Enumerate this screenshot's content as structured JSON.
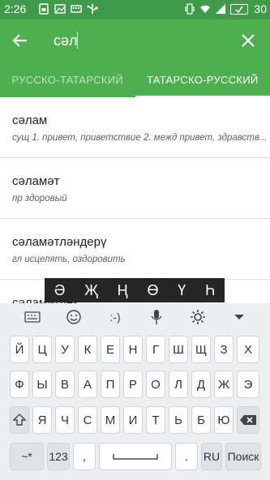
{
  "status": {
    "time": "2:26",
    "battery": "30",
    "icons": [
      "sim-icon",
      "gallery-icon",
      "usb-icon",
      "usb-debug-icon",
      "vibrate-icon",
      "wifi-icon",
      "signal-icon",
      "battery-icon"
    ]
  },
  "colors": {
    "statusbar": "#3f9a49",
    "toolbar": "#4caf50",
    "special_bar": "#262626",
    "keyboard_bg": "#eceff1"
  },
  "search": {
    "query": "сәл",
    "placeholder": ""
  },
  "tabs": [
    {
      "label": "РУССКО-ТАТАРСКИЙ",
      "active": false
    },
    {
      "label": "ТАТАРСКО-РУССКИЙ",
      "active": true
    }
  ],
  "results": [
    {
      "word": "сәлам",
      "definition": "сущ 1. привет, приветствие 2. межд привет, здравств..."
    },
    {
      "word": "сәламәт",
      "definition": "пр здоровый"
    },
    {
      "word": "сәламәтләндерү",
      "definition": "гл исцелять, оздоровить"
    },
    {
      "word": "сәламәтлек",
      "definition": ""
    }
  ],
  "special_chars": [
    "Ә",
    "Җ",
    "Ң",
    "Ө",
    "Ү",
    "Һ"
  ],
  "keyboard": {
    "toolbar_icons": [
      "keyboard-icon",
      "emoji-icon",
      "emoticon-icon",
      "mic-icon",
      "settings-icon",
      "collapse-icon"
    ],
    "emoticon_label": ":-)",
    "row1": [
      "Й",
      "Ц",
      "У",
      "К",
      "Е",
      "Н",
      "Г",
      "Ш",
      "Щ",
      "З",
      "Х"
    ],
    "row2": [
      "Ф",
      "Ы",
      "В",
      "А",
      "П",
      "Р",
      "О",
      "Л",
      "Д",
      "Ж",
      "Э"
    ],
    "row3": [
      "Я",
      "Ч",
      "С",
      "М",
      "И",
      "Т",
      "Ь",
      "Б",
      "Ю"
    ],
    "symbols_key": "~*",
    "numbers_key": "123",
    "comma_key": ",",
    "period_key": ".",
    "lang_key": "RU",
    "search_key": "Поиск"
  }
}
